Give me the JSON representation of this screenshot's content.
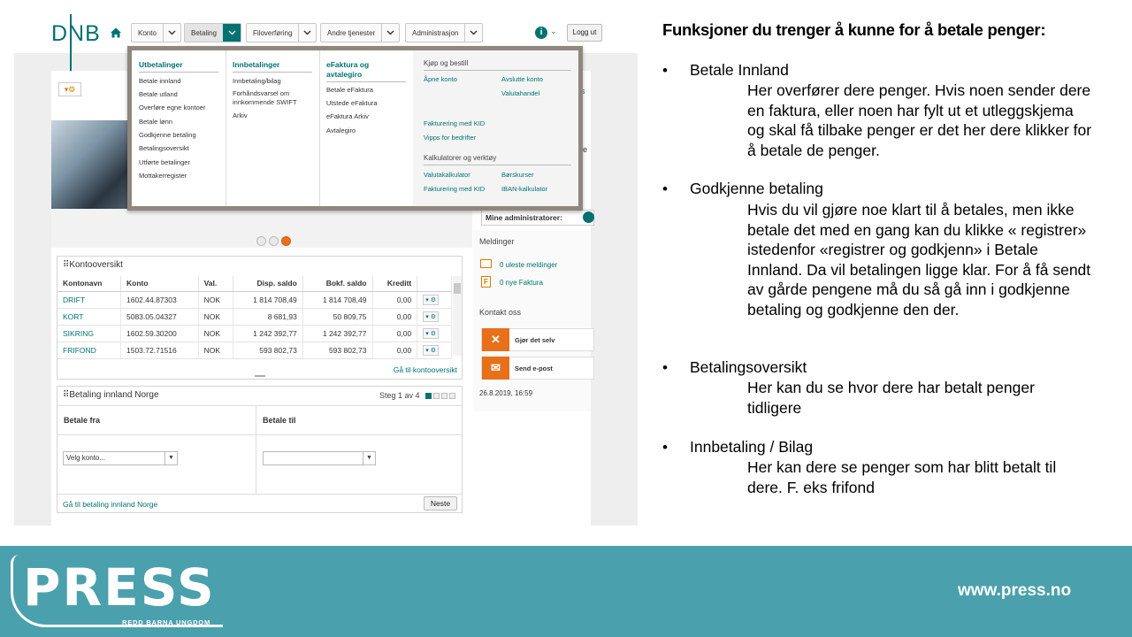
{
  "app": {
    "logo": "DNB",
    "nav": [
      {
        "label": "Konto"
      },
      {
        "label": "Betaling"
      },
      {
        "label": "Filoverføring"
      },
      {
        "label": "Andre tjenester"
      },
      {
        "label": "Administrasjon"
      }
    ],
    "logout": "Logg ut",
    "info": "i",
    "mega_menu": {
      "utbetalinger": {
        "title": "Utbetalinger",
        "items": [
          "Betale innland",
          "Betale utland",
          "Overføre egne kontoer",
          "Betale lønn",
          "Godkjenne betaling",
          "Betalingsoversikt",
          "Utførte betalinger",
          "Mottakerregister"
        ]
      },
      "innbetalinger": {
        "title": "Innbetalinger",
        "items": [
          "Innbetaling/bilag",
          "Forhåndsvarsel om innkommende SWIFT",
          "Arkiv"
        ]
      },
      "efaktura": {
        "title": "eFaktura og avtalegiro",
        "items": [
          "Betale eFaktura",
          "Utstede eFaktura",
          "eFaktura Arkiv",
          "Avtalegiro"
        ]
      },
      "kjop": {
        "title": "Kjøp og bestill",
        "items": [
          "Åpne konto",
          "Avslutte konto",
          "Valutahandel",
          "Fakturering med KID",
          "Vipps for bedrifter"
        ]
      },
      "kalk": {
        "title": "Kalkulatorer og verktøy",
        "items": [
          "Valutakalkulator",
          "Børskurser",
          "Fakturering med KID",
          "IBAN-kalkulator"
        ]
      }
    },
    "right": {
      "administrators": "Mine administratorer:",
      "messages_title": "Meldinger",
      "unread": "0 uleste meldinger",
      "invoices": "0 nye Faktura",
      "contact_title": "Kontakt oss",
      "self_service": "Gjør det selv",
      "email": "Send e-post",
      "timestamp": "26.8.2019, 16:59",
      "edge_chars": [
        "s",
        "e"
      ]
    },
    "konto": {
      "title": "Kontooversikt",
      "headers": [
        "Kontonavn",
        "Konto",
        "Val.",
        "Disp. saldo",
        "Bokf. saldo",
        "Kreditt"
      ],
      "rows": [
        [
          "DRIFT",
          "1602.44.87303",
          "NOK",
          "1 814 708,49",
          "1 814 708,49",
          "0,00"
        ],
        [
          "KORT",
          "5083.05.04327",
          "NOK",
          "8 681,93",
          "50 809,75",
          "0,00"
        ],
        [
          "SIKRING",
          "1602.59.30200",
          "NOK",
          "1 242 392,77",
          "1 242 392,77",
          "0,00"
        ],
        [
          "FRIFOND",
          "1503.72.71516",
          "NOK",
          "593 802,73",
          "593 802,73",
          "0,00"
        ]
      ],
      "link": "Gå til kontooversikt"
    },
    "betaling": {
      "title": "Betaling innland Norge",
      "step": "Steg 1 av 4",
      "from_label": "Betale fra",
      "to_label": "Betale til",
      "from_placeholder": "Velg konto...",
      "to_placeholder": "",
      "link": "Gå til betaling innland Norge",
      "next": "Neste"
    }
  },
  "slide": {
    "title": "Funksjoner du trenger å kunne for å betale penger:",
    "bullet": "•",
    "sections": [
      {
        "head": "Betale Innland",
        "body": "Her overfører dere penger. Hvis noen sender dere en faktura, eller noen har fylt ut et utleggskjema og skal få tilbake penger er det her dere klikker for å betale de penger."
      },
      {
        "head": "Godkjenne betaling",
        "body": "Hvis du vil gjøre noe klart til å betales, men ikke betale det med en gang kan du klikke « registrer» istedenfor «registrer og godkjenn» i Betale Innland. Da vil betalingen ligge klar. For å få sendt av gårde pengene må du så gå inn i godkjenne betaling og godkjenne den der."
      },
      {
        "head": "Betalingsoversikt",
        "body": "Her kan du se hvor dere har betalt penger tidligere"
      },
      {
        "head": "Innbetaling / Bilag",
        "body": "Her kan dere se penger som har blitt betalt til dere. F. eks frifond"
      }
    ]
  },
  "footer": {
    "logo": "PRESS",
    "sub": "REDD BARNA UNGDOM",
    "url": "www.press.no",
    "color": "#4ba0ad"
  }
}
